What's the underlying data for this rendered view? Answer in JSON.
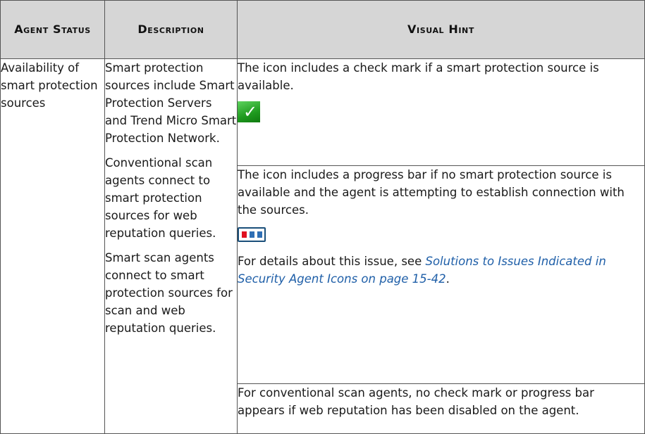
{
  "table": {
    "headers": {
      "agent_status": "Agent Status",
      "description": "Description",
      "visual_hint": "Visual Hint"
    },
    "row": {
      "agent_status": "Availability of smart protection sources",
      "description": [
        "Smart protection sources include Smart Protection Servers and Trend Micro Smart Protection Network.",
        "Conventional scan agents connect to smart protection sources for web reputation queries.",
        "Smart scan agents connect to smart protection sources for scan and web reputation queries."
      ],
      "hints": [
        {
          "text": "The icon includes a check mark if a smart protection source is available.",
          "icon": "check-mark-icon"
        },
        {
          "text": "The icon includes a progress bar if no smart protection source is available and the agent is attempting to establish connection with the sources.",
          "icon": "progress-bar-icon",
          "details_prefix": "For details about this issue, see ",
          "details_link": "Solutions to Issues Indicated in Security Agent Icons on page 15-42",
          "details_suffix": "."
        },
        {
          "text": "For conventional scan agents, no check mark or progress bar appears if web reputation has been disabled on the agent."
        }
      ]
    }
  },
  "colors": {
    "header_bg": "#d6d6d6",
    "border": "#555555",
    "link": "#1f5fa8",
    "check_green": "#1f9a1f",
    "progress_red": "#e01020",
    "progress_blue": "#2f6fb5"
  }
}
